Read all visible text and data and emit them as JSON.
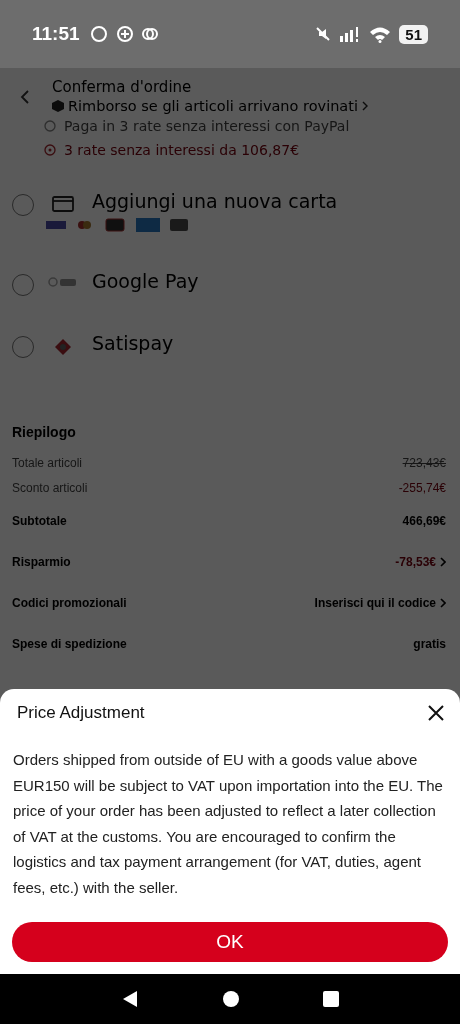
{
  "status_bar": {
    "time": "11:51",
    "battery": "51"
  },
  "header": {
    "title": "Conferma d'ordine",
    "subtitle": "Rimborso se gli articoli arrivano rovinati"
  },
  "installments": [
    {
      "kind": "paypal",
      "text": "Paga in 3 rate senza interessi con PayPal"
    },
    {
      "kind": "klarna",
      "text": "3 rate senza interessi da 106,87€"
    }
  ],
  "payment_methods": [
    {
      "kind": "card",
      "label": "Aggiungi una nuova carta",
      "selected": false
    },
    {
      "kind": "gpay",
      "label": "Google Pay",
      "selected": false
    },
    {
      "kind": "satispay",
      "label": "Satispay",
      "selected": false
    }
  ],
  "summary": {
    "title": "Riepilogo",
    "rows": [
      {
        "kind": "minor",
        "label": "Totale articoli",
        "value": "723,43€",
        "struck": true,
        "red": false,
        "chevron": false
      },
      {
        "kind": "minor",
        "label": "Sconto articoli",
        "value": "-255,74€",
        "struck": false,
        "red": true,
        "chevron": false
      },
      {
        "kind": "major",
        "label": "Subtotale",
        "value": "466,69€",
        "struck": false,
        "red": false,
        "chevron": false
      },
      {
        "kind": "major",
        "label": "Risparmio",
        "value": "-78,53€",
        "struck": false,
        "red": true,
        "chevron": true
      },
      {
        "kind": "major",
        "label": "Codici promozionali",
        "value": "Inserisci qui il codice",
        "struck": false,
        "red": false,
        "chevron": true
      },
      {
        "kind": "major",
        "label": "Spese di spedizione",
        "value": "gratis",
        "struck": false,
        "red": false,
        "chevron": false
      }
    ]
  },
  "dialog": {
    "title": "Price Adjustment",
    "body": "Orders shipped from outside of EU with a goods value above EUR150 will be subject to VAT upon importation into the EU.  The price of your order has been adjusted to reflect a later collection of VAT at the customs.  You are encouraged to confirm the logistics and tax payment arrangement (for VAT, duties, agent fees, etc.) with the seller.",
    "button": "OK"
  }
}
